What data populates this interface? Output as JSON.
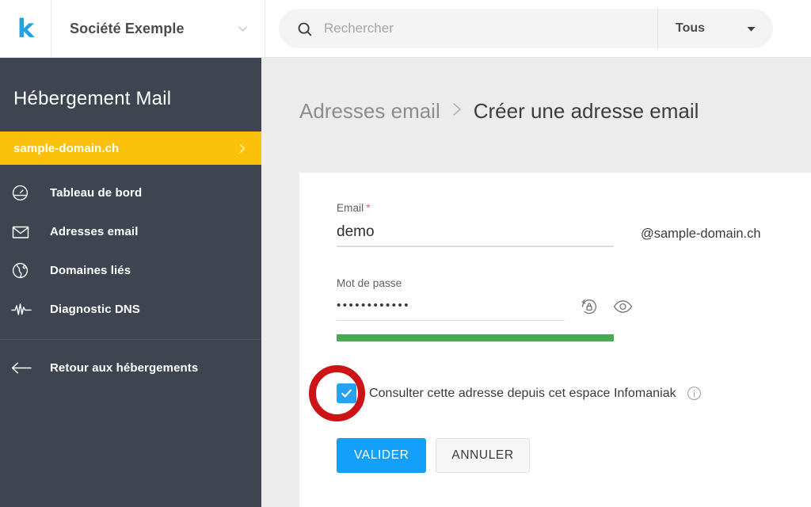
{
  "topbar": {
    "logo_text": "k",
    "logo_color": "#22a1e8",
    "org_name": "Société Exemple",
    "search_placeholder": "Rechercher",
    "search_value": "",
    "filter_label": "Tous",
    "filter_options": [
      "Tous"
    ]
  },
  "sidebar": {
    "title": "Hébergement Mail",
    "active_domain": "sample-domain.ch",
    "active_color": "#fcc10b",
    "background_color": "#3e4450",
    "items": [
      {
        "label": "Tableau de bord",
        "icon": "dashboard-gauge-icon"
      },
      {
        "label": "Adresses email",
        "icon": "envelope-icon"
      },
      {
        "label": "Domaines liés",
        "icon": "globe-icon"
      },
      {
        "label": "Diagnostic DNS",
        "icon": "pulse-icon"
      }
    ],
    "bottom_item": {
      "label": "Retour aux hébergements",
      "icon": "arrow-left-icon"
    }
  },
  "breadcrumb": {
    "parent": "Adresses email",
    "separator": "›",
    "current": "Créer une adresse email"
  },
  "form": {
    "email": {
      "label": "Email",
      "required_marker": "*",
      "value": "demo",
      "placeholder": "",
      "suffix": "@sample-domain.ch"
    },
    "password": {
      "label": "Mot de passe",
      "value": "••••••••••••",
      "masked_display": "••••••••••••",
      "generate_icon": "lock-refresh-icon",
      "reveal_icon": "eye-icon",
      "strength_color": "#4aa94f"
    },
    "checkbox": {
      "checked": true,
      "label": "Consulter cette adresse depuis cet espace Infomaniak",
      "info_icon": "info-circle-icon",
      "accent_color": "#25a3f0"
    },
    "buttons": {
      "submit": "VALIDER",
      "cancel": "ANNULER",
      "submit_color": "#14a0fa"
    }
  },
  "annotation": {
    "shape": "circle-highlight",
    "color": "#cc1417",
    "target": "checkbox"
  }
}
